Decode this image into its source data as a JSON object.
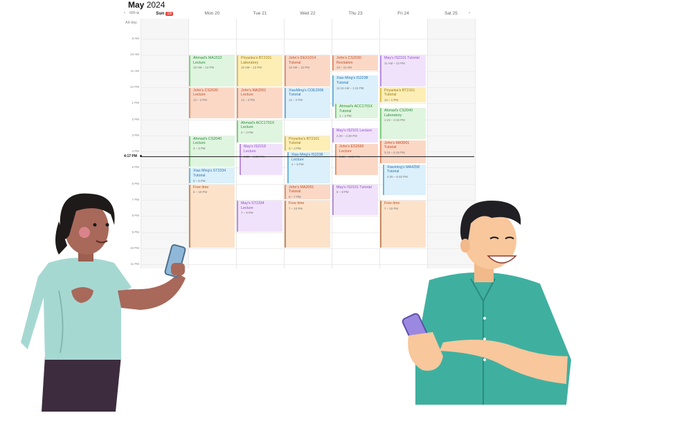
{
  "calendar": {
    "month": "May",
    "year": "2024",
    "nav_prev": "‹",
    "nav_today": "om-a",
    "nav_next": "›",
    "all_day_label": "All-day",
    "now_label": "4:17 PM",
    "days": [
      {
        "name": "Sun",
        "date": "19",
        "today": true
      },
      {
        "name": "Mon",
        "date": "20"
      },
      {
        "name": "Tue",
        "date": "21"
      },
      {
        "name": "Wed",
        "date": "22"
      },
      {
        "name": "Thu",
        "date": "23"
      },
      {
        "name": "Fri",
        "date": "24"
      },
      {
        "name": "Sat",
        "date": "25"
      }
    ],
    "hours": [
      "9 AM",
      "10 AM",
      "11 AM",
      "12 PM",
      "1 PM",
      "2 PM",
      "3 PM",
      "4 PM",
      "5 PM",
      "6 PM",
      "7 PM",
      "8 PM",
      "9 PM",
      "10 PM",
      "11 PM"
    ],
    "events": [
      {
        "day": 1,
        "start": 10,
        "end": 12,
        "title": "Ahmad's MA1522",
        "sub": "Lecture",
        "time": "10 AM – 12 PM",
        "color": "green"
      },
      {
        "day": 1,
        "start": 12,
        "end": 14,
        "title": "John's CS2030",
        "sub": "Lecture",
        "time": "12 – 2 PM",
        "color": "orange"
      },
      {
        "day": 1,
        "start": 15,
        "end": 17,
        "title": "Ahmad's CS2040",
        "sub": "Lecture",
        "time": "3 – 5 PM",
        "color": "green"
      },
      {
        "day": 1,
        "start": 17,
        "end": 18,
        "title": "Xiao Ming's ST2334",
        "sub": "Tutorial",
        "time": "5 – 6 PM",
        "color": "blue"
      },
      {
        "day": 1,
        "start": 18,
        "end": 22,
        "title": "Free time",
        "sub": "",
        "time": "6 – 10 PM",
        "color": "peach"
      },
      {
        "day": 2,
        "start": 10,
        "end": 12,
        "title": "Priyanka's BT2101",
        "sub": "Laboratory",
        "time": "10 AM – 12 PM",
        "color": "yellow"
      },
      {
        "day": 2,
        "start": 12,
        "end": 14,
        "title": "John's MA2001",
        "sub": "Lecture",
        "time": "12 – 2 PM",
        "color": "orange"
      },
      {
        "day": 2,
        "start": 14,
        "end": 15.5,
        "title": "Ahmad's ACC1701X",
        "sub": "Lecture",
        "time": "2 – 4 PM",
        "color": "green"
      },
      {
        "day": 2,
        "start": 15.5,
        "end": 17.5,
        "title": "May's IS2218",
        "sub": "Lecture",
        "time": "3:30 – 5:30 PM",
        "color": "purple",
        "indent": true
      },
      {
        "day": 2,
        "start": 19,
        "end": 21,
        "title": "May's ST2334",
        "sub": "Lecture",
        "time": "7 – 9 PM",
        "color": "purple"
      },
      {
        "day": 3,
        "start": 10,
        "end": 12,
        "title": "John's DEX1014",
        "sub": "Tutorial",
        "time": "10 AM – 12 PM",
        "color": "orange"
      },
      {
        "day": 3,
        "start": 12,
        "end": 14,
        "title": "XiaoMing's COE2006",
        "sub": "Tutorial",
        "time": "12 – 2 PM",
        "color": "blue"
      },
      {
        "day": 3,
        "start": 15,
        "end": 16,
        "title": "Priyanka's BT2101",
        "sub": "Tutorial",
        "time": "3 – 4 PM",
        "color": "yellow"
      },
      {
        "day": 3,
        "start": 16,
        "end": 18,
        "title": "Xiao Ming's IS2238",
        "sub": "Lecture",
        "time": "4 – 6 PM",
        "color": "blue",
        "indent": true
      },
      {
        "day": 3,
        "start": 18,
        "end": 19,
        "title": "John's MA2001",
        "sub": "Tutorial",
        "time": "6 – 7 PM",
        "color": "orange"
      },
      {
        "day": 3,
        "start": 19,
        "end": 22,
        "title": "Free time",
        "sub": "",
        "time": "7 – 10 PM",
        "color": "peach"
      },
      {
        "day": 4,
        "start": 10,
        "end": 11,
        "title": "John's CS2030",
        "sub": "Recitation",
        "time": "10 – 11 AM",
        "color": "orange"
      },
      {
        "day": 4,
        "start": 11.25,
        "end": 13.25,
        "title": "Xiao Ming's IS2238",
        "sub": "Tutorial",
        "time": "11:15 AM – 1:15 PM",
        "color": "blue"
      },
      {
        "day": 4,
        "start": 13,
        "end": 14,
        "title": "Ahmad's ACC1701X",
        "sub": "Tutorial",
        "time": "1 – 2 PM",
        "color": "green",
        "indent": true
      },
      {
        "day": 4,
        "start": 14.5,
        "end": 15.5,
        "title": "May's IS2101 Lecture",
        "sub": "",
        "time": "2:30 – 4:30 PM",
        "color": "purple"
      },
      {
        "day": 4,
        "start": 15.5,
        "end": 17.5,
        "title": "John's ES2660",
        "sub": "Lecture",
        "time": "3:30 – 5:30 PM",
        "color": "orange",
        "indent": true
      },
      {
        "day": 4,
        "start": 18,
        "end": 20,
        "title": "May's IS2101 Tutorial",
        "sub": "",
        "time": "6 – 8 PM",
        "color": "purple"
      },
      {
        "day": 5,
        "start": 10,
        "end": 12,
        "title": "May's IS2101 Tutorial",
        "sub": "",
        "time": "11 AM – 12 PM",
        "color": "purple"
      },
      {
        "day": 5,
        "start": 12,
        "end": 13,
        "title": "Priyanka's BT2101",
        "sub": "Tutorial",
        "time": "12 – 1 PM",
        "color": "yellow"
      },
      {
        "day": 5,
        "start": 13.25,
        "end": 15.25,
        "title": "Ahmad's CS2040",
        "sub": "Laboratory",
        "time": "1:15 – 3:15 PM",
        "color": "green"
      },
      {
        "day": 5,
        "start": 15.25,
        "end": 16.75,
        "title": "John's MA3001",
        "sub": "Tutorial",
        "time": "3:15 – 5:15 PM",
        "color": "orange"
      },
      {
        "day": 5,
        "start": 16.75,
        "end": 18.75,
        "title": "Xiaoming's MA4258 Tutorial",
        "sub": "",
        "time": "4:45 – 6:45 PM",
        "color": "blue",
        "indent": true
      },
      {
        "day": 5,
        "start": 19,
        "end": 22,
        "title": "Free time",
        "sub": "",
        "time": "7 – 10 PM",
        "color": "peach"
      }
    ]
  },
  "colors": {
    "green": {
      "bg": "#dff5df",
      "bar": "#7ed07e",
      "text": "#2e8b3e"
    },
    "orange": {
      "bg": "#fbd8c6",
      "bar": "#e8916a",
      "text": "#c0502a"
    },
    "blue": {
      "bg": "#dbf0fb",
      "bar": "#6db5e0",
      "text": "#2a73b0"
    },
    "yellow": {
      "bg": "#fdeeb5",
      "bar": "#e2c14b",
      "text": "#9a7a12"
    },
    "purple": {
      "bg": "#f1e2fb",
      "bar": "#b98de0",
      "text": "#8e4fc6"
    },
    "peach": {
      "bg": "#fde2ca",
      "bar": "#c88a5c",
      "text": "#b5561d"
    }
  },
  "illustrations": {
    "woman": "woman-with-phone",
    "man": "man-with-phone"
  }
}
